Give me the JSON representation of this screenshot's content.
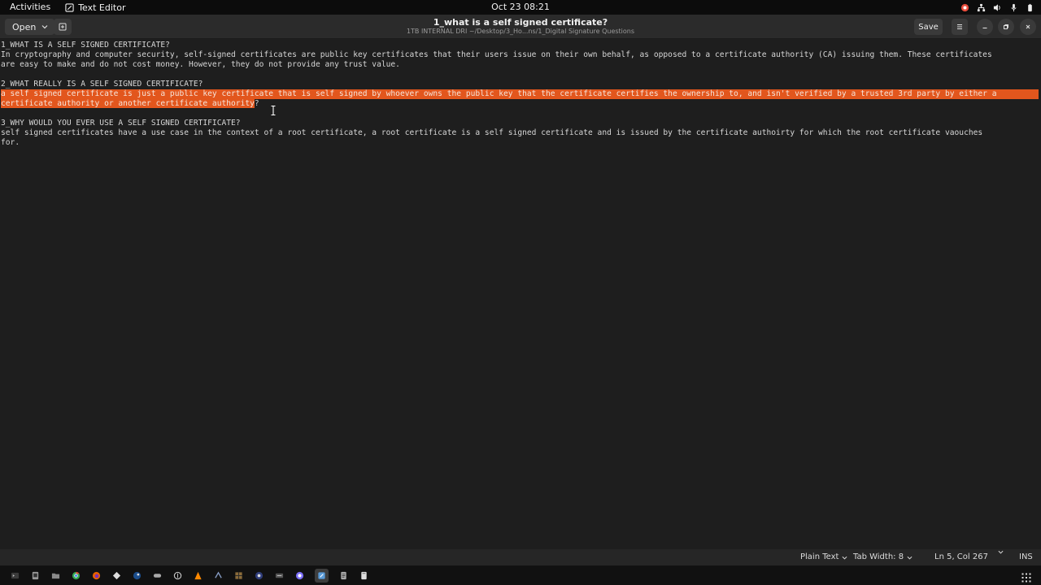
{
  "topbar": {
    "activities": "Activities",
    "app_name": "Text Editor",
    "clock": "Oct 23  08:21"
  },
  "header": {
    "open_label": "Open",
    "title": "1_what is a self signed certificate?",
    "subtitle": "1TB INTERNAL DRI ~/Desktop/3_Ho...ns/1_Digital Signature Questions",
    "save_label": "Save"
  },
  "editor": {
    "lines": [
      "1_WHAT IS A SELF SIGNED CERTIFICATE?",
      "In cryptography and computer security, self-signed certificates are public key certificates that their users issue on their own behalf, as opposed to a certificate authority (CA) issuing them. These certificates",
      "are easy to make and do not cost money. However, they do not provide any trust value.",
      "",
      "2_WHAT REALLY IS A SELF SIGNED CERTIFICATE?",
      "a self signed certificate is just a public key certificate that is self signed by whoever owns the public key that the certificate certifies the ownership to, and isn't verified by a trusted 3rd party by either a",
      "certificate authority or another certificate authority",
      "",
      "3_WHY WOULD YOU EVER USE A SELF SIGNED CERTIFICATE?",
      "self signed certificates have a use case in the context of a root certificate, a root certificate is a self signed certificate and is issued by the certificate authoirty for which the root certificate vaouches",
      "for."
    ],
    "line7_tail": "?"
  },
  "statusbar": {
    "language": "Plain Text",
    "tab_width": "Tab Width: 8",
    "position": "Ln 5, Col 267",
    "mode": "INS"
  },
  "colors": {
    "selection": "#e2561d",
    "background": "#1e1e1e",
    "header": "#2b2b2b"
  },
  "dock": {
    "icons": [
      "terminal-icon",
      "files-icon",
      "folder-icon",
      "chrome-icon",
      "firefox-icon",
      "app-icon",
      "steam-icon",
      "game-icon",
      "vpn-icon",
      "vlc-icon",
      "app2-icon",
      "app3-icon",
      "app4-icon",
      "app5-icon",
      "chat-icon",
      "text-editor-icon",
      "document-icon",
      "trash-icon"
    ]
  }
}
